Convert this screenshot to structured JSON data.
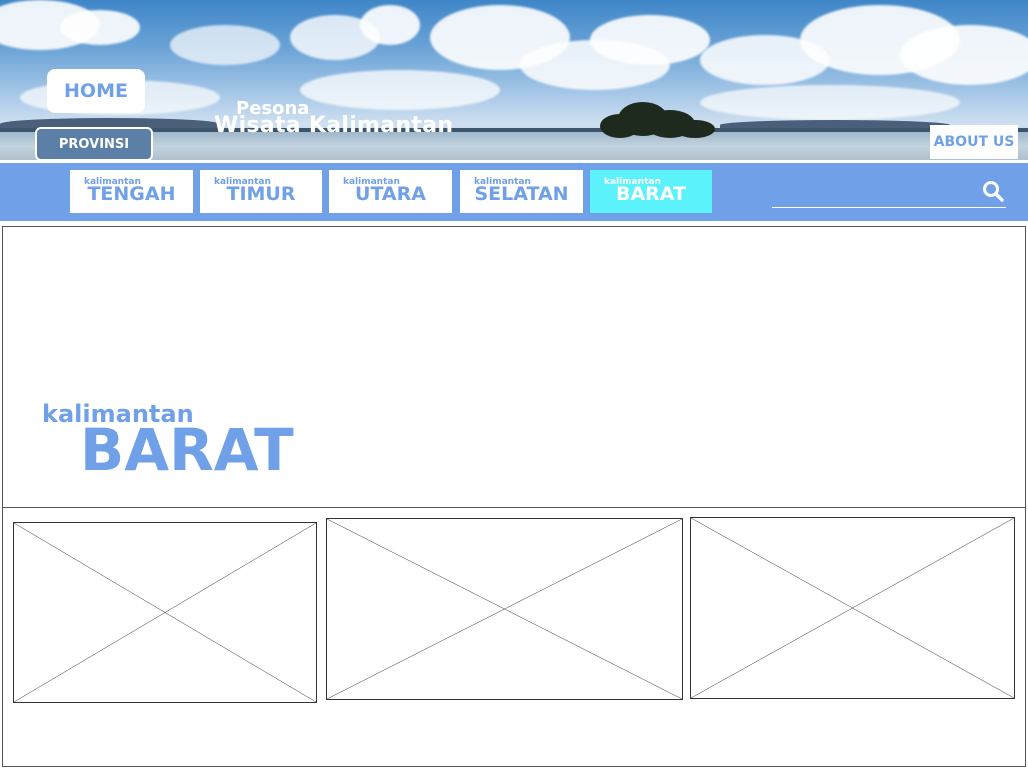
{
  "header": {
    "home_label": "HOME",
    "provinsi_label": "PROVINSI",
    "title_small": "Pesona",
    "title_big": "Wisata Kalimantan",
    "about_label": "ABOUT US"
  },
  "nav": {
    "tabs": [
      {
        "small": "kalimantan",
        "label": "TENGAH",
        "active": false
      },
      {
        "small": "kalimantan",
        "label": "TIMUR",
        "active": false
      },
      {
        "small": "kalimantan",
        "label": "UTARA",
        "active": false
      },
      {
        "small": "kalimantan",
        "label": "SELATAN",
        "active": false
      },
      {
        "small": "kalimantan",
        "label": "BARAT",
        "active": true
      }
    ],
    "search_icon": "search-icon"
  },
  "hero": {
    "small": "kalimantan",
    "big": "BARAT"
  },
  "cards": [
    {
      "placeholder": "image-placeholder"
    },
    {
      "placeholder": "image-placeholder"
    },
    {
      "placeholder": "image-placeholder"
    }
  ],
  "colors": {
    "accent": "#6fa0e8",
    "active_tab": "#5cf2fb",
    "provinsi_button": "#5c7fa8"
  }
}
